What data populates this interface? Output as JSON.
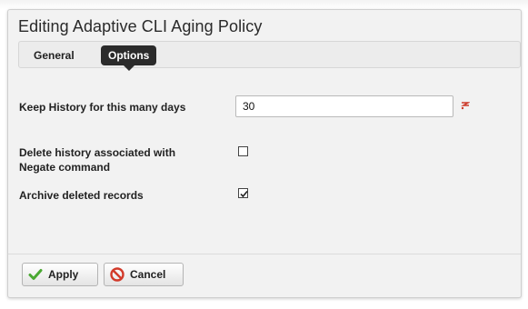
{
  "dialog": {
    "title": "Editing Adaptive CLI Aging Policy"
  },
  "tabs": [
    {
      "label": "General",
      "active": false
    },
    {
      "label": "Options",
      "active": true
    }
  ],
  "form": {
    "keep_history": {
      "label": "Keep History for this many days",
      "value": "30",
      "required": true
    },
    "delete_negate": {
      "label": "Delete history associated with Negate command",
      "checked": false
    },
    "archive_deleted": {
      "label": "Archive deleted records",
      "checked": true
    }
  },
  "buttons": {
    "apply": {
      "label": "Apply",
      "icon": "checkmark-icon"
    },
    "cancel": {
      "label": "Cancel",
      "icon": "cancel-icon"
    }
  },
  "colors": {
    "active_tab": "#2b2b2b",
    "apply_icon": "#4aa832",
    "cancel_icon": "#d23a2a",
    "required_marker": "#cc3b2b"
  }
}
